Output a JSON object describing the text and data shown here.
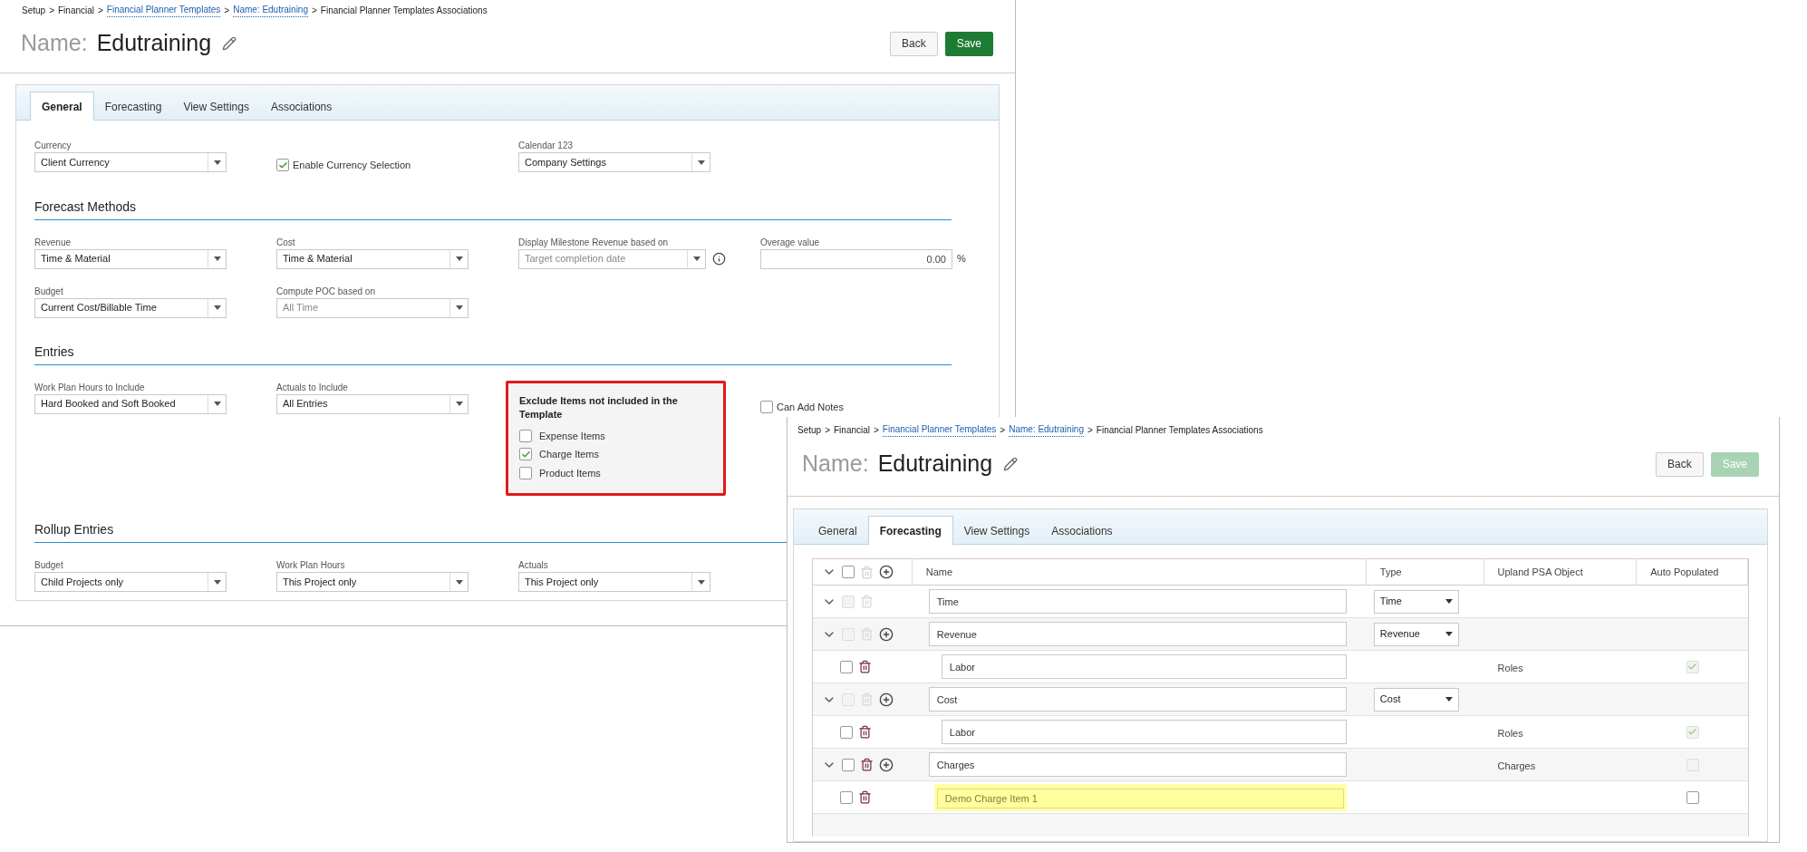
{
  "general_window": {
    "breadcrumb_separator": ">",
    "breadcrumb": [
      {
        "text": "Setup",
        "link": false
      },
      {
        "text": "Financial",
        "link": false
      },
      {
        "text": "Financial Planner Templates",
        "link": true
      },
      {
        "text": "Name: Edutraining",
        "link": true
      },
      {
        "text": "Financial Planner Templates Associations",
        "link": false
      }
    ],
    "title_label": "Name:",
    "title": "Edutraining",
    "buttons": [
      {
        "label": "Back",
        "kind": "secondary",
        "disabled": false
      },
      {
        "label": "Save",
        "kind": "primary",
        "disabled": false
      }
    ],
    "tabs": [
      {
        "label": "General",
        "selected": true
      },
      {
        "label": "Forecasting",
        "selected": false
      },
      {
        "label": "View Settings",
        "selected": false
      },
      {
        "label": "Associations",
        "selected": false
      }
    ],
    "top_fields": [
      {
        "kind": "select",
        "label": "Currency",
        "value": "Client  Currency",
        "disabled": false
      },
      {
        "kind": "checkbox",
        "label": "Enable Currency Selection",
        "checked": true
      },
      {
        "kind": "select",
        "label": "Calendar 123",
        "value": "Company Settings",
        "disabled": false
      }
    ],
    "sections": [
      {
        "title": "Forecast Methods",
        "rows": [
          [
            {
              "kind": "select",
              "label": "Revenue",
              "value": "Time & Material",
              "disabled": false
            },
            {
              "kind": "select",
              "label": "Cost",
              "value": "Time & Material",
              "disabled": false
            },
            {
              "kind": "select",
              "label": "Display Milestone Revenue based on",
              "value": "Target completion date",
              "disabled": true,
              "info": true
            },
            {
              "kind": "number",
              "label": "Overage value",
              "value": "0.00",
              "suffix": "%"
            }
          ],
          [
            {
              "kind": "select",
              "label": "Budget",
              "value": "Current Cost/Billable Time",
              "disabled": false
            },
            {
              "kind": "select",
              "label": "Compute POC based on",
              "value": "All Time",
              "disabled": true
            }
          ]
        ]
      },
      {
        "title": "Entries",
        "rows": [
          [
            {
              "kind": "select",
              "label": "Work Plan Hours to Include",
              "value": "Hard Booked and Soft Booked",
              "disabled": false
            },
            {
              "kind": "select",
              "label": "Actuals to Include",
              "value": "All Entries",
              "disabled": false
            },
            {
              "kind": "group",
              "title": "Exclude Items not included in the Template",
              "highlighted": true,
              "options": [
                {
                  "label": "Expense Items",
                  "checked": false
                },
                {
                  "label": "Charge Items",
                  "checked": true
                },
                {
                  "label": "Product Items",
                  "checked": false
                }
              ]
            },
            {
              "kind": "checkbox",
              "label": "Can Add Notes",
              "checked": false
            }
          ]
        ]
      },
      {
        "title": "Rollup Entries",
        "rows": [
          [
            {
              "kind": "select",
              "label": "Budget",
              "value": "Child Projects only",
              "disabled": false
            },
            {
              "kind": "select",
              "label": "Work Plan Hours",
              "value": "This Project  only",
              "disabled": false
            },
            {
              "kind": "select",
              "label": "Actuals",
              "value": "This Project  only",
              "disabled": false
            }
          ]
        ]
      }
    ]
  },
  "forecasting_window": {
    "breadcrumb_separator": ">",
    "breadcrumb": [
      {
        "text": "Setup",
        "link": false
      },
      {
        "text": "Financial",
        "link": false
      },
      {
        "text": "Financial Planner Templates",
        "link": true
      },
      {
        "text": "Name: Edutraining",
        "link": true
      },
      {
        "text": "Financial Planner Templates Associations",
        "link": false
      }
    ],
    "title_label": "Name:",
    "title": "Edutraining",
    "buttons": [
      {
        "label": "Back",
        "kind": "secondary",
        "disabled": false
      },
      {
        "label": "Save",
        "kind": "primary",
        "disabled": true
      }
    ],
    "tabs": [
      {
        "label": "General",
        "selected": false
      },
      {
        "label": "Forecasting",
        "selected": true
      },
      {
        "label": "View Settings",
        "selected": false
      },
      {
        "label": "Associations",
        "selected": false
      }
    ],
    "table": {
      "columns": [
        "Name",
        "Type",
        "Upland PSA Object",
        "Auto Populated"
      ],
      "header_checked": false,
      "rows": [
        {
          "name": "Time",
          "type": "Time",
          "expanded": true,
          "checked": false,
          "locked": true,
          "can_add": false,
          "children": []
        },
        {
          "name": "Revenue",
          "type": "Revenue",
          "expanded": true,
          "checked": false,
          "locked": true,
          "can_add": true,
          "children": [
            {
              "name": "Labor",
              "checked": false,
              "object": "Roles",
              "auto_populated": true,
              "auto_editable": false,
              "highlighted": false
            }
          ]
        },
        {
          "name": "Cost",
          "type": "Cost",
          "expanded": true,
          "checked": false,
          "locked": true,
          "can_add": true,
          "children": [
            {
              "name": "Labor",
              "checked": false,
              "object": "Roles",
              "auto_populated": true,
              "auto_editable": false,
              "highlighted": false
            }
          ]
        },
        {
          "name": "Charges",
          "object": "Charges",
          "auto_populated": false,
          "auto_editable": false,
          "expanded": true,
          "checked": false,
          "locked": false,
          "can_add": true,
          "children": [
            {
              "name": "Demo Charge Item 1",
              "checked": false,
              "auto_populated": false,
              "auto_editable": true,
              "highlighted": true
            }
          ]
        }
      ]
    }
  }
}
